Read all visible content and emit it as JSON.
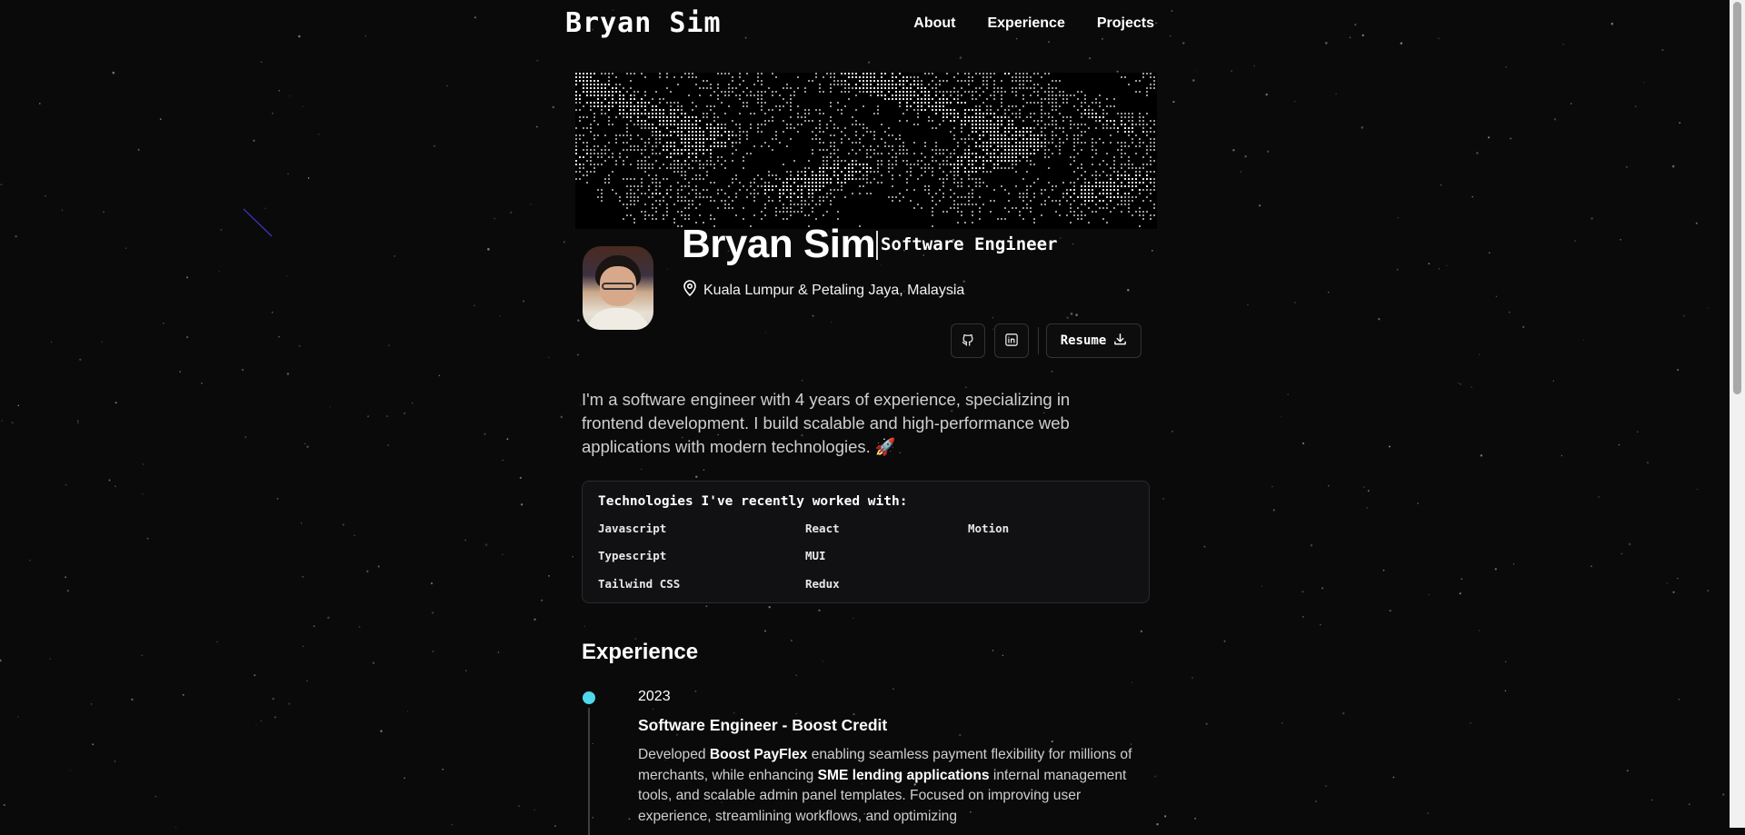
{
  "nav": {
    "brand": "Bryan Sim",
    "links": [
      "About",
      "Experience",
      "Projects"
    ]
  },
  "profile": {
    "name": "Bryan Sim",
    "title": "Software Engineer",
    "location": "Kuala Lumpur & Petaling Jaya, Malaysia",
    "location_icon": "map-pin-icon",
    "social": [
      {
        "name": "github",
        "icon": "github-icon"
      },
      {
        "name": "linkedin",
        "icon": "linkedin-icon"
      }
    ],
    "resume_label": "Resume",
    "resume_icon": "download-icon"
  },
  "bio": "I'm a software engineer with 4 years of experience, specializing in frontend development. I build scalable and high-performance web applications with modern technologies. 🚀",
  "tech": {
    "heading": "Technologies I've recently worked with:",
    "items": [
      "Javascript",
      "Typescript",
      "Tailwind CSS",
      "React",
      "MUI",
      "Redux",
      "Motion"
    ]
  },
  "experience": {
    "heading": "Experience",
    "items": [
      {
        "year": "2023",
        "role": "Software Engineer - Boost Credit",
        "desc_parts": [
          "Developed ",
          "Boost PayFlex",
          " enabling seamless payment flexibility for millions of merchants, while enhancing ",
          "SME lending applications",
          " internal management tools, and scalable admin panel templates. Focused on improving user experience, streamlining workflows, and optimizing"
        ]
      }
    ]
  },
  "colors": {
    "background": "#0a0a0b",
    "accent": "#4fd7ea",
    "text": "#ffffff",
    "muted": "#cfcfcf"
  }
}
